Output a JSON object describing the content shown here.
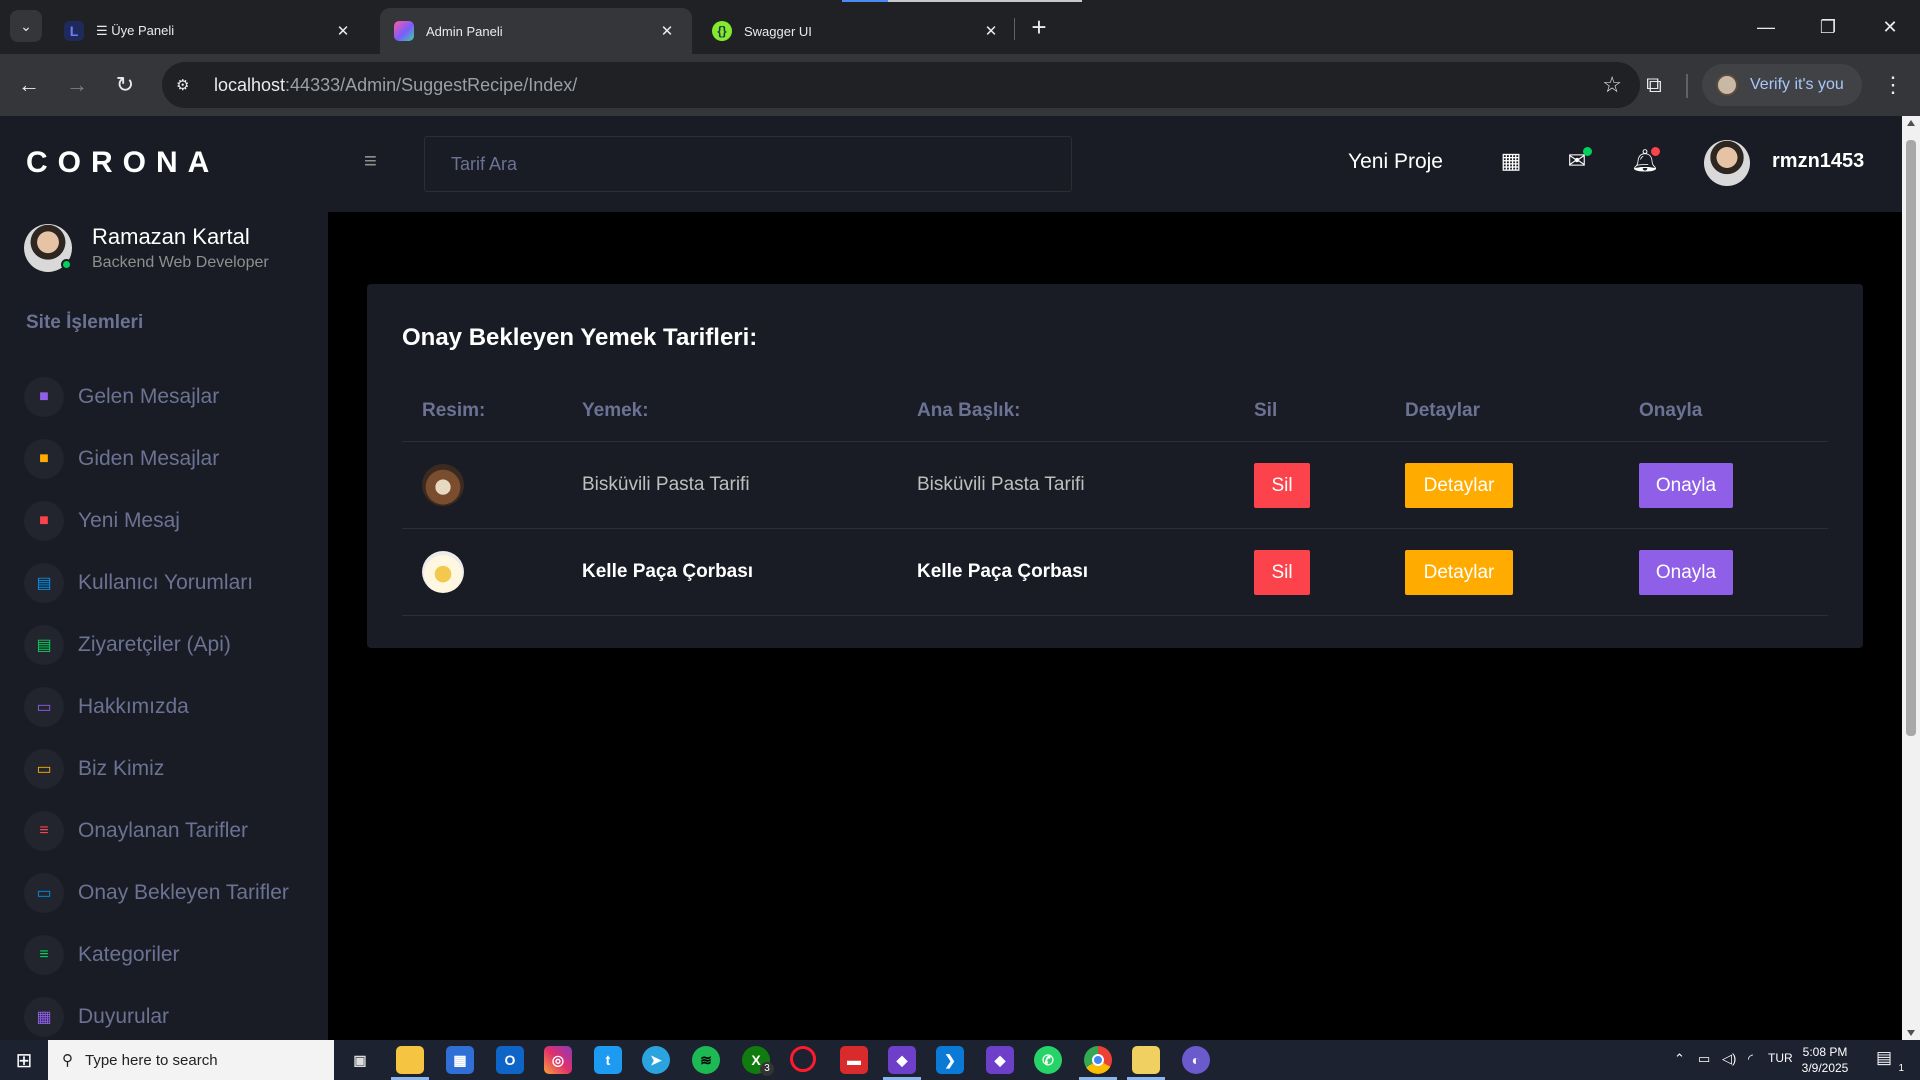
{
  "browser": {
    "tabs": [
      {
        "title": "☰ Üye Paneli"
      },
      {
        "title": "Admin Paneli"
      },
      {
        "title": "Swagger UI"
      }
    ],
    "url_host": "localhost",
    "url_rest": ":44333/Admin/SuggestRecipe/Index/",
    "verify_label": "Verify it's you"
  },
  "sidebar": {
    "brand": "CORONA",
    "profile_name": "Ramazan Kartal",
    "profile_role": "Backend Web Developer",
    "section_heading": "Site İşlemleri",
    "items": [
      {
        "label": "Gelen Mesajlar",
        "icon": "message-icon",
        "color": "#8f5fe8"
      },
      {
        "label": "Giden Mesajlar",
        "icon": "message-icon",
        "color": "#ffab00"
      },
      {
        "label": "Yeni Mesaj",
        "icon": "message-icon",
        "color": "#fc424a"
      },
      {
        "label": "Kullanıcı Yorumları",
        "icon": "document-icon",
        "color": "#0090e7"
      },
      {
        "label": "Ziyaretçiler (Api)",
        "icon": "document-icon",
        "color": "#00d25b"
      },
      {
        "label": "Hakkımızda",
        "icon": "laptop-icon",
        "color": "#8f5fe8"
      },
      {
        "label": "Biz Kimiz",
        "icon": "laptop-icon",
        "color": "#ffab00"
      },
      {
        "label": "Onaylanan Tarifler",
        "icon": "playlist-icon",
        "color": "#fc424a"
      },
      {
        "label": "Onay Bekleyen Tarifler",
        "icon": "laptop-icon",
        "color": "#0090e7"
      },
      {
        "label": "Kategoriler",
        "icon": "playlist-icon",
        "color": "#00d25b"
      },
      {
        "label": "Duyurular",
        "icon": "table-icon",
        "color": "#8f5fe8"
      }
    ]
  },
  "topnav": {
    "search_placeholder": "Tarif Ara",
    "new_project": "Yeni Proje",
    "username": "rmzn1453"
  },
  "main": {
    "card_title": "Onay Bekleyen Yemek Tarifleri:",
    "columns": [
      "Resim:",
      "Yemek:",
      "Ana Başlık:",
      "Sil",
      "Detaylar",
      "Onayla"
    ],
    "rows": [
      {
        "food": "Bisküvili Pasta Tarifi",
        "title": "Bisküvili Pasta Tarifi",
        "delete": "Sil",
        "details": "Detaylar",
        "approve": "Onayla"
      },
      {
        "food": "Kelle Paça Çorbası",
        "title": "Kelle Paça Çorbası",
        "delete": "Sil",
        "details": "Detaylar",
        "approve": "Onayla"
      }
    ]
  },
  "taskbar": {
    "search_placeholder": "Type here to search",
    "lang": "TUR",
    "time": "5:08 PM",
    "date": "3/9/2025",
    "badge_count": "3",
    "notification_count": "1"
  },
  "colors": {
    "danger": "#fc424a",
    "warning": "#ffab00",
    "primary": "#8f5fe8",
    "success": "#00d25b",
    "info": "#0090e7"
  }
}
